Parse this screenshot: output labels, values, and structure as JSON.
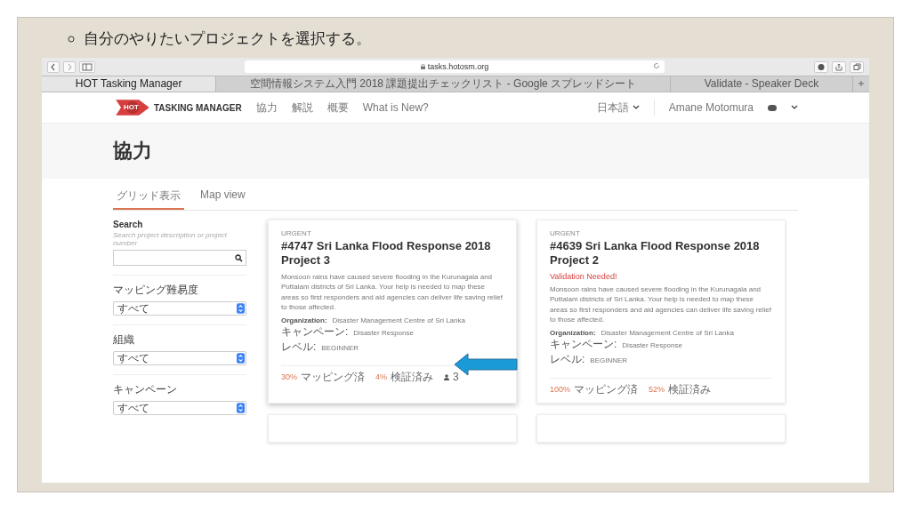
{
  "slide": {
    "bullet": "自分のやりたいプロジェクトを選択する。"
  },
  "browser": {
    "url": "tasks.hotosm.org",
    "tabs": [
      {
        "label": "HOT Tasking Manager",
        "selected": true
      },
      {
        "label": "空間情報システム入門 2018 課題提出チェックリスト - Google スプレッドシート",
        "selected": false
      },
      {
        "label": "Validate - Speaker Deck",
        "selected": false
      }
    ]
  },
  "site": {
    "logo_badge": "HOT",
    "logo_text": "TASKING MANAGER",
    "nav": [
      "協力",
      "解説",
      "概要",
      "What is New?"
    ],
    "language": "日本語",
    "user": "Amane Motomura"
  },
  "page_title": "協力",
  "view_tabs": [
    {
      "label": "グリッド表示",
      "selected": true
    },
    {
      "label": "Map view",
      "selected": false
    }
  ],
  "filters": {
    "search": {
      "label": "Search",
      "placeholder": "Search project description or project number"
    },
    "selects": [
      {
        "label": "マッピング難易度",
        "value": "すべて"
      },
      {
        "label": "組織",
        "value": "すべて"
      },
      {
        "label": "キャンペーン",
        "value": "すべて"
      }
    ]
  },
  "projects": [
    {
      "priority": "URGENT",
      "title": "#4747 Sri Lanka Flood Response 2018 Project 3",
      "validation_needed": false,
      "description": "Monsoon rains have caused severe flooding in the Kurunagala and Puttalam districts of Sri Lanka. Your help is needed to map these areas so first responders and aid agencies can deliver life saving relief to those affected.",
      "organization_label": "Organization:",
      "organization": "Disaster Management Centre of Sri Lanka",
      "campaign_label": "キャンペーン:",
      "campaign": "Disaster Response",
      "level_label": "レベル:",
      "level_value": "BEGINNER",
      "mapped": "30%",
      "mapped_label": "マッピング済",
      "validated": "4%",
      "validated_label": "検証済み",
      "contributors": "3"
    },
    {
      "priority": "URGENT",
      "title": "#4639 Sri Lanka Flood Response 2018 Project 2",
      "validation_needed": true,
      "validation_text": "Validation Needed!",
      "description": "Monsoon rains have caused severe flooding in the Kurunagala and Puttalam districts of Sri Lanka. Your help is needed to map these areas so first responders and aid agencies can deliver life saving relief to those affected.",
      "organization_label": "Organization:",
      "organization": "Disaster Management Centre of Sri Lanka",
      "campaign_label": "キャンペーン:",
      "campaign": "Disaster Response",
      "level_label": "レベル:",
      "level_value": "BEGINNER",
      "mapped": "100%",
      "mapped_label": "マッピング済",
      "validated": "52%",
      "validated_label": "検証済み"
    }
  ]
}
